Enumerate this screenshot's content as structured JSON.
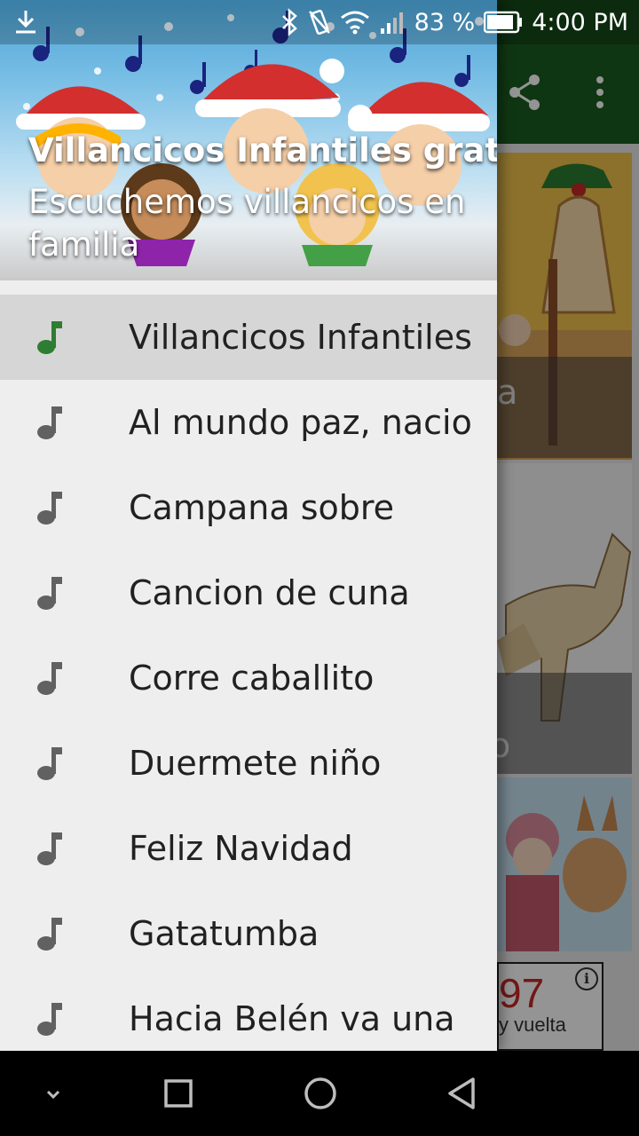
{
  "status_bar": {
    "battery_percent": "83 %",
    "time": "4:00 PM",
    "icons": [
      "download-icon",
      "bluetooth-icon",
      "vibrate-icon",
      "wifi-icon",
      "signal-icon",
      "battery-icon"
    ]
  },
  "drawer": {
    "header_title": "Villancicos Infantiles gratis",
    "header_subtitle": "Escuchemos villancicos en familia",
    "items": [
      {
        "label": "Villancicos Infantiles",
        "icon": "music-note-icon",
        "selected": true
      },
      {
        "label": "Al mundo paz, nacio",
        "icon": "music-note-icon",
        "selected": false
      },
      {
        "label": "Campana sobre",
        "icon": "music-note-icon",
        "selected": false
      },
      {
        "label": "Cancion de cuna",
        "icon": "music-note-icon",
        "selected": false
      },
      {
        "label": "Corre caballito",
        "icon": "music-note-icon",
        "selected": false
      },
      {
        "label": "Duermete niño",
        "icon": "music-note-icon",
        "selected": false
      },
      {
        "label": "Feliz Navidad",
        "icon": "music-note-icon",
        "selected": false
      },
      {
        "label": "Gatatumba",
        "icon": "music-note-icon",
        "selected": false
      },
      {
        "label": "Hacia Belén va una",
        "icon": "music-note-icon",
        "selected": false
      }
    ]
  },
  "background": {
    "card1_text": "a",
    "card2_text": "o",
    "ad_price": "97",
    "ad_sub": "y vuelta"
  },
  "colors": {
    "toolbar": "#1b5e20",
    "selected_icon": "#2e7d32",
    "icon": "#616161"
  },
  "nav_bar": {
    "buttons": [
      "chevron-down-icon",
      "recents-icon",
      "home-icon",
      "back-icon"
    ]
  }
}
